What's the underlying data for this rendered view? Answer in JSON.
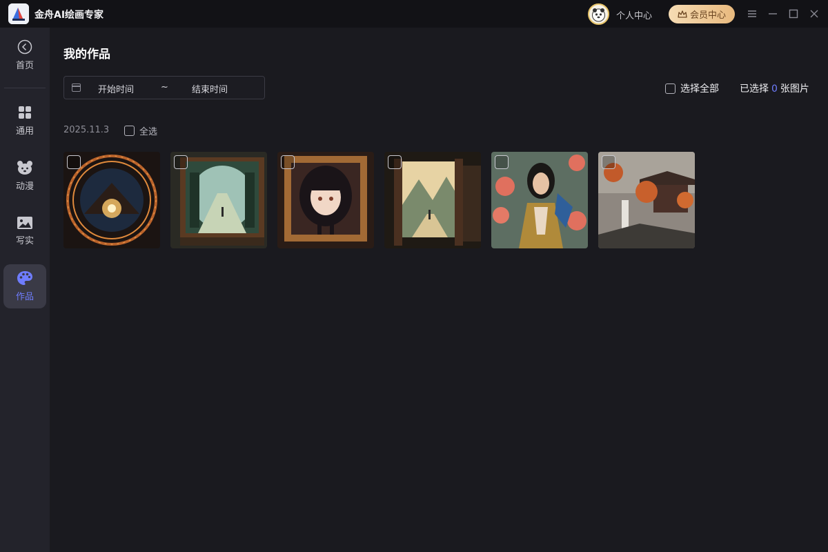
{
  "app": {
    "title": "金舟AI绘画专家"
  },
  "header": {
    "personal_center": "个人中心",
    "vip_label": "会员中心"
  },
  "sidebar": {
    "items": [
      {
        "label": "首页",
        "icon": "back-circle-icon"
      },
      {
        "label": "通用",
        "icon": "grid-icon"
      },
      {
        "label": "动漫",
        "icon": "bear-icon"
      },
      {
        "label": "写实",
        "icon": "image-icon"
      },
      {
        "label": "作品",
        "icon": "palette-icon",
        "active": true
      }
    ]
  },
  "main": {
    "title": "我的作品",
    "date_start_placeholder": "开始时间",
    "date_separator": "~",
    "date_end_placeholder": "结束时间",
    "select_all_label": "选择全部",
    "selected_prefix": "已选择",
    "selected_count": "0",
    "selected_suffix": "张图片",
    "groups": [
      {
        "date": "2025.11.3",
        "select_label": "全选",
        "image_count": 6
      }
    ]
  },
  "colors": {
    "accent": "#6f7dff",
    "vip_gold": "#e8b97e",
    "background": "#1a1a1f",
    "sidebar": "#23232b"
  }
}
